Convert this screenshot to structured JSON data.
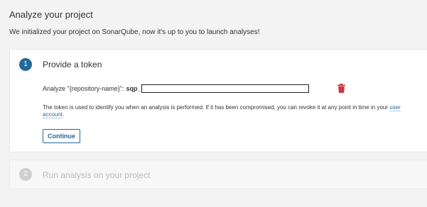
{
  "page": {
    "title": "Analyze your project",
    "subtitle": "We initialized your project on SonarQube, now it's up to you to launch analyses!"
  },
  "step1": {
    "number": "1",
    "title": "Provide a token",
    "token_label": "Analyze \"{repository-name}\":",
    "token_prefix": "sqp_",
    "token_value": "",
    "help_text_before": "The token is used to identify you when an analysis is performed. If it has been compromised, you can revoke it at any point in time in your ",
    "help_link": "user account",
    "help_text_after": ".",
    "continue_label": "Continue"
  },
  "step2": {
    "number": "2",
    "title": "Run analysis on your project"
  },
  "colors": {
    "accent": "#236a97",
    "delete": "#d4333f",
    "disabled": "#cfcfcf"
  },
  "icons": {
    "delete": "trash-icon"
  }
}
